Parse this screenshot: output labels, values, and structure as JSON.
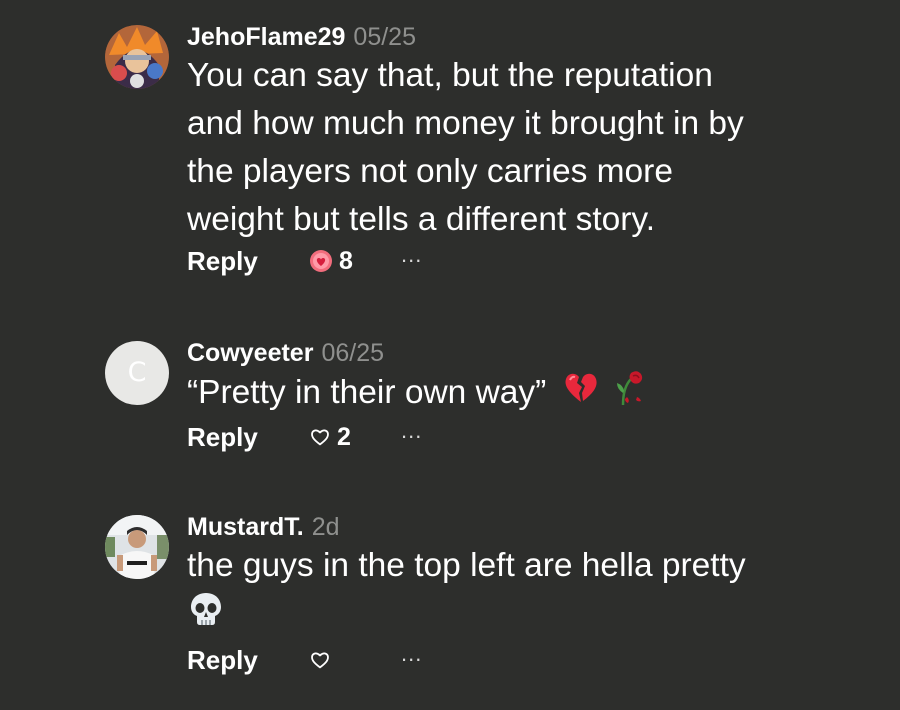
{
  "comments": [
    {
      "username": "JehoFlame29",
      "date": "05/25",
      "avatar_icon": "anime-character-avatar",
      "lines": [
        "You can say that, but the reputation",
        "and how much money it brought in by",
        "the players not only carries more",
        "weight but tells a different story."
      ],
      "reply_label": "Reply",
      "reaction_icon": "heart-face-emoji-icon",
      "reaction_count": "8",
      "more_label": "..."
    },
    {
      "username": "Cowyeeter",
      "date": "06/25",
      "avatar_letter": "C",
      "text": "“Pretty in their own way”",
      "emojis": [
        "broken-heart-emoji-icon",
        "wilted-rose-emoji-icon"
      ],
      "reply_label": "Reply",
      "reaction_icon": "heart-outline-icon",
      "reaction_count": "2",
      "more_label": "..."
    },
    {
      "username": "MustardT.",
      "date": "2d",
      "avatar_icon": "person-photo-avatar",
      "text": "the guys in the top left are hella pretty",
      "emojis": [
        "skull-emoji-icon"
      ],
      "reply_label": "Reply",
      "reaction_icon": "heart-outline-icon",
      "more_label": "..."
    }
  ],
  "colors": {
    "background": "#2d2e2c",
    "text": "#ffffff",
    "muted": "#8f908e",
    "reaction_pink": "#e8405a"
  }
}
